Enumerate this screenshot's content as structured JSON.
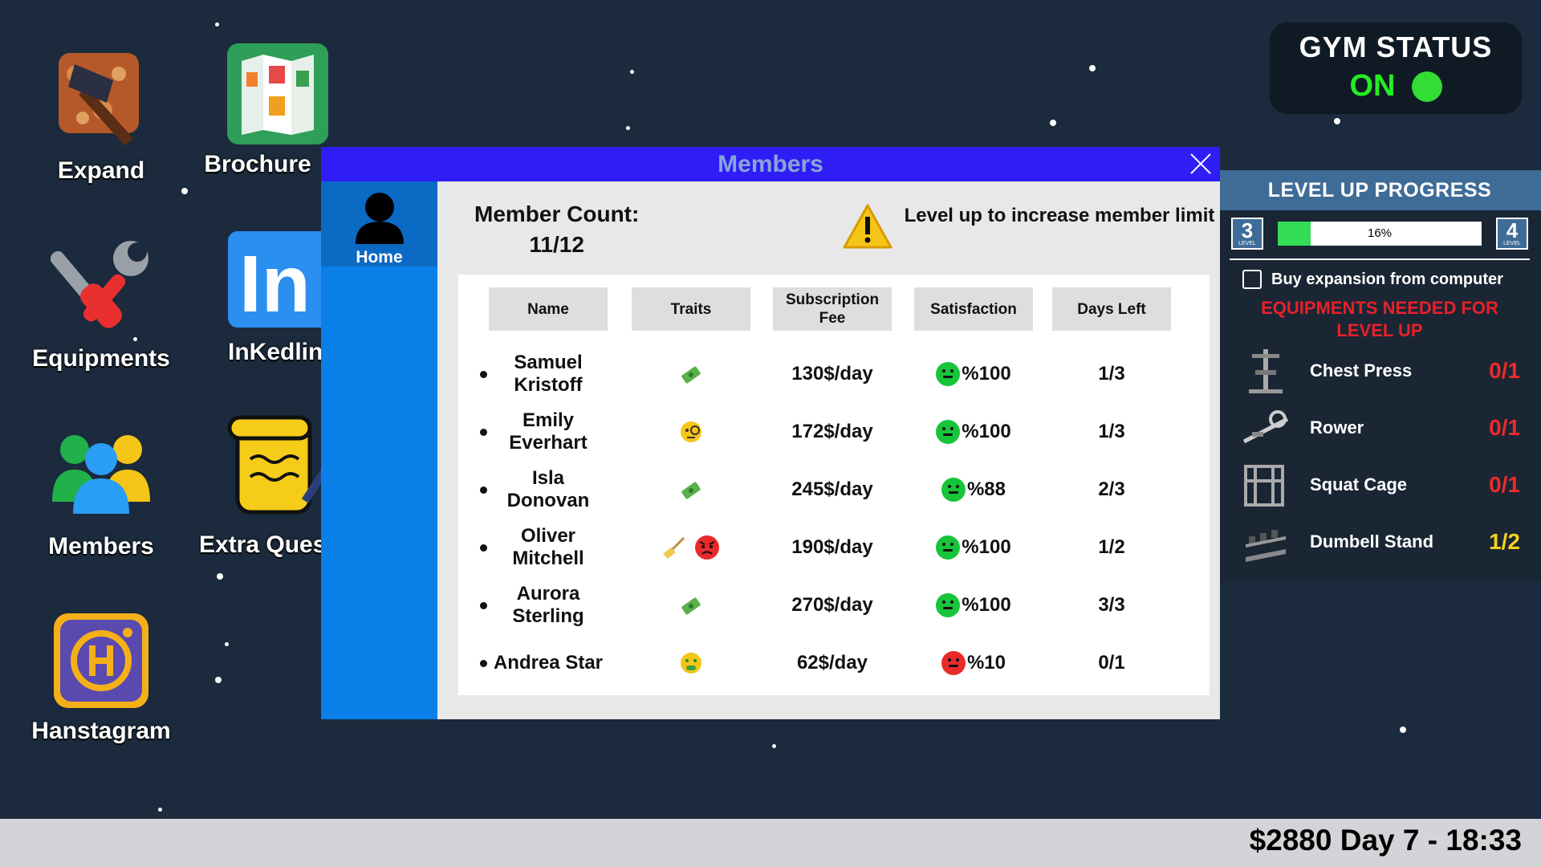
{
  "desktop_icons": [
    {
      "label": "Expand",
      "icon": "hammer-icon"
    },
    {
      "label": "Brochure",
      "icon": "brochure-icon"
    },
    {
      "label": "Equipments",
      "icon": "tools-icon"
    },
    {
      "label": "InKedlin",
      "icon": "inkedlin-icon"
    },
    {
      "label": "Members",
      "icon": "members-icon"
    },
    {
      "label": "Extra Quests",
      "icon": "scroll-icon"
    },
    {
      "label": "Hanstagram",
      "icon": "hanstagram-icon"
    }
  ],
  "gym_status": {
    "title": "GYM STATUS",
    "state": "ON",
    "state_color": "#22ee22"
  },
  "level_up": {
    "title": "LEVEL UP PROGRESS",
    "current_level": "3",
    "next_level": "4",
    "level_word": "LEVEL",
    "progress_text": "16%",
    "progress": 0.16,
    "buy_expansion_label": "Buy expansion from computer",
    "buy_expansion_checked": false,
    "equipment_heading_1": "EQUIPMENTS NEEDED FOR",
    "equipment_heading_2": "LEVEL UP",
    "equipment": [
      {
        "name": "Chest Press",
        "count": "0/1",
        "color": "#ee2a2a",
        "icon": "chest-press-icon"
      },
      {
        "name": "Rower",
        "count": "0/1",
        "color": "#ee2a2a",
        "icon": "rower-icon"
      },
      {
        "name": "Squat Cage",
        "count": "0/1",
        "color": "#ee2a2a",
        "icon": "squat-cage-icon"
      },
      {
        "name": "Dumbell Stand",
        "count": "1/2",
        "color": "#f5d020",
        "icon": "dumbell-stand-icon"
      }
    ]
  },
  "members_window": {
    "title": "Members",
    "sidebar_home": "Home",
    "member_count_label": "Member Count:",
    "member_count_value": "11/12",
    "warning_text": "Level up to increase member limit",
    "columns": [
      "Name",
      "Traits",
      "Subscription Fee",
      "Satisfaction",
      "Days Left"
    ],
    "rows": [
      {
        "name": "Samuel Kristoff",
        "traits": [
          "money-icon"
        ],
        "fee": "130$/day",
        "satisfaction": "%100",
        "mood": "happy",
        "days": "1/3"
      },
      {
        "name": "Emily Everhart",
        "traits": [
          "monocle-face-icon"
        ],
        "fee": "172$/day",
        "satisfaction": "%100",
        "mood": "happy",
        "days": "1/3"
      },
      {
        "name": "Isla Donovan",
        "traits": [
          "money-icon"
        ],
        "fee": "245$/day",
        "satisfaction": "%88",
        "mood": "happy",
        "days": "2/3"
      },
      {
        "name": "Oliver Mitchell",
        "traits": [
          "broom-icon",
          "angry-face-icon"
        ],
        "fee": "190$/day",
        "satisfaction": "%100",
        "mood": "happy",
        "days": "1/2"
      },
      {
        "name": "Aurora Sterling",
        "traits": [
          "money-icon"
        ],
        "fee": "270$/day",
        "satisfaction": "%100",
        "mood": "happy",
        "days": "3/3"
      },
      {
        "name": "Andrea Star",
        "traits": [
          "money-mouth-face-icon"
        ],
        "fee": "62$/day",
        "satisfaction": "%10",
        "mood": "angry",
        "days": "0/1"
      }
    ]
  },
  "bottom_bar": {
    "status": "$2880 Day 7 - 18:33"
  }
}
